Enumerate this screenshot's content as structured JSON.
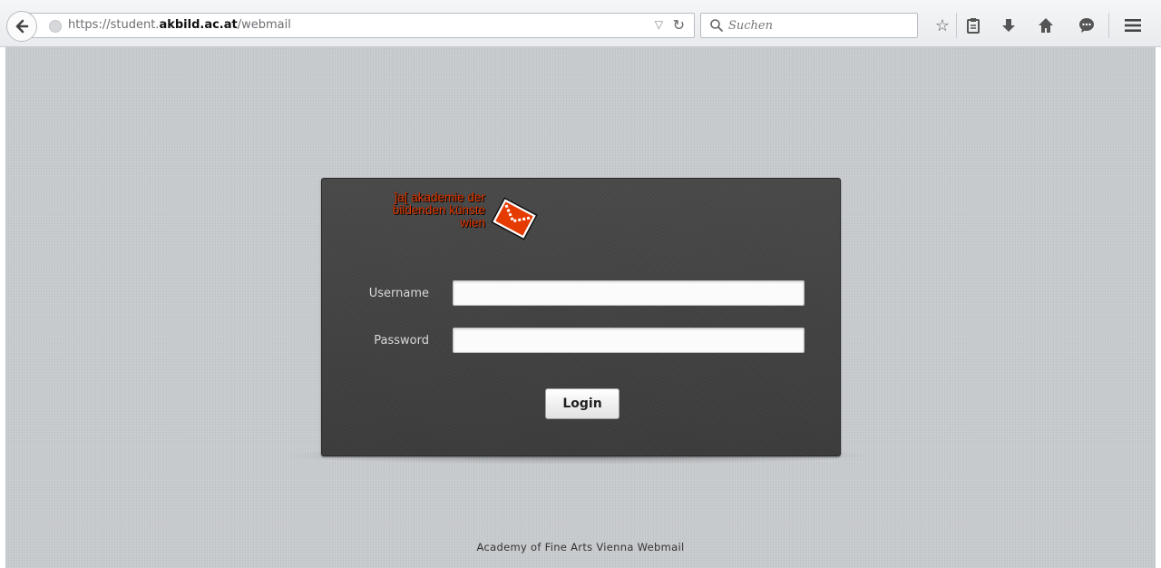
{
  "browser": {
    "url_prefix": "https://student.",
    "url_domain": "akbild.ac.at",
    "url_path": "/webmail",
    "search_placeholder": "Suchen"
  },
  "icons": {
    "back": "back-arrow-icon",
    "site": "globe-icon",
    "dropdown": "dropdown-arrow-icon",
    "reload": "reload-icon",
    "search": "search-icon",
    "bookmark": "star-icon",
    "reading_list": "clipboard-icon",
    "downloads": "download-icon",
    "home": "home-icon",
    "chat": "chat-icon",
    "menu": "hamburger-menu-icon"
  },
  "logo": {
    "line1": "]a[ akademie der",
    "line2": "bildenden künste",
    "line3": "wien",
    "color": "#e63b00"
  },
  "form": {
    "username_label": "Username",
    "username_value": "",
    "password_label": "Password",
    "password_value": "",
    "login_label": "Login"
  },
  "footer": {
    "text": "Academy of Fine Arts Vienna Webmail"
  }
}
